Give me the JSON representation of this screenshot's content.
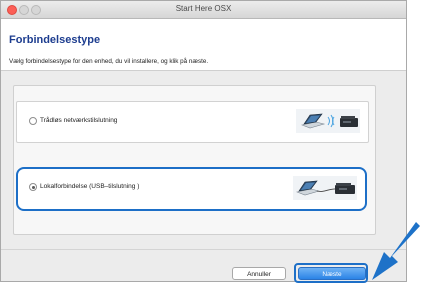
{
  "window": {
    "title": "Start Here OSX"
  },
  "header": {
    "title": "Forbindelsestype",
    "subtitle": "Vælg forbindelsestype for den enhed, du vil installere, og klik på næste."
  },
  "options": [
    {
      "label": "Trådløs netværkstilslutning",
      "selected": false,
      "icon": "wireless-connection-icon"
    },
    {
      "label": "Lokalforbindelse (USB–tilslutning )",
      "selected": true,
      "icon": "usb-connection-icon"
    }
  ],
  "buttons": {
    "cancel": "Annuller",
    "next": "Næste"
  },
  "colors": {
    "accent": "#1d6fc7",
    "title": "#1d3d8f",
    "next_button": "#2b83e6"
  }
}
